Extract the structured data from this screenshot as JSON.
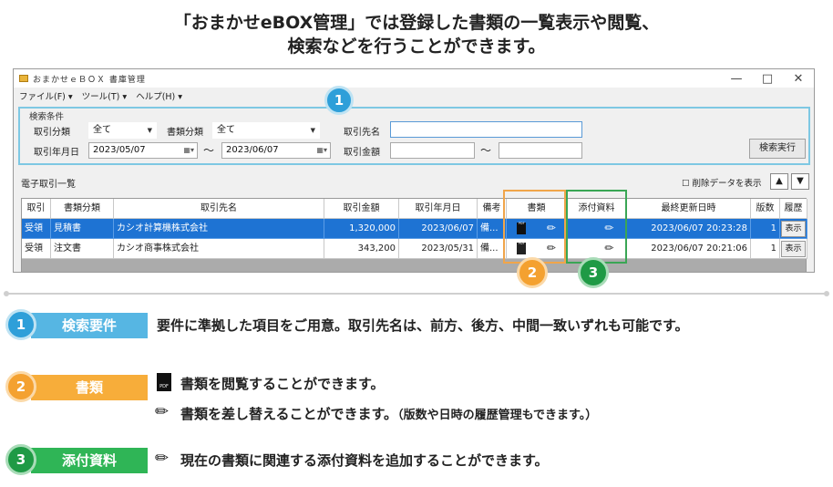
{
  "headline": {
    "line1": "「おまかせeBOX管理」では登録した書類の一覧表示や閲覧、",
    "line2": "検索などを行うことができます。"
  },
  "window": {
    "title": "おまかせｅＢＯＸ 書庫管理",
    "controls": {
      "minimize": "—",
      "maximize": "□",
      "close": "✕"
    },
    "menu": [
      "ファイル(F) ▾",
      "ツール(T) ▾",
      "ヘルプ(H) ▾"
    ]
  },
  "search": {
    "legend": "検索条件",
    "torihiki_bunrui_label": "取引分類",
    "torihiki_bunrui_value": "全て",
    "shorui_bunrui_label": "書類分類",
    "shorui_bunrui_value": "全て",
    "torihikisaki_label": "取引先名",
    "torihikisaki_value": "",
    "date_label": "取引年月日",
    "date_from": "2023/05/07",
    "date_to": "2023/06/07",
    "tilde": "〜",
    "kingaku_label": "取引金額",
    "kingaku_from": "",
    "kingaku_to": "",
    "run_button": "検索実行"
  },
  "list": {
    "title": "電子取引一覧",
    "show_deleted": "☐ 削除データを表示",
    "up_button": "▲",
    "down_button": "▼",
    "columns": [
      "取引",
      "書類分類",
      "取引先名",
      "取引金額",
      "取引年月日",
      "備考",
      "書類",
      "添付資料",
      "最終更新日時",
      "版数",
      "履歴"
    ],
    "rows": [
      {
        "torihiki": "受領",
        "bunrui": "見積書",
        "saki": "カシオ計算機株式会社",
        "kingaku": "1,320,000",
        "date": "2023/06/07",
        "biko": "備...",
        "updated": "2023/06/07 20:23:28",
        "hansu": "1",
        "rireki": "表示"
      },
      {
        "torihiki": "受領",
        "bunrui": "注文書",
        "saki": "カシオ商事株式会社",
        "kingaku": "343,200",
        "date": "2023/05/31",
        "biko": "備...",
        "updated": "2023/06/07 20:21:06",
        "hansu": "1",
        "rireki": "表示"
      }
    ]
  },
  "badges": {
    "one": "1",
    "two": "2",
    "three": "3"
  },
  "legend": {
    "items": [
      {
        "num": "1",
        "tag": "検索要件",
        "text": "要件に準拠した項目をご用意。取引先名は、前方、後方、中間一致いずれも可能です。"
      },
      {
        "num": "2",
        "tag": "書類",
        "text_view": "書類を閲覧することができます。",
        "text_replace": "書類を差し替えることができます。",
        "text_replace_note": "（版数や日時の履歴管理もできます。）"
      },
      {
        "num": "3",
        "tag": "添付資料",
        "text": "現在の書類に関連する添付資料を追加することができます。"
      }
    ]
  },
  "icons": {
    "pdf": "pdf-icon",
    "pen": "pen-icon",
    "pen_glyph": "✏"
  },
  "colors": {
    "blue": "#2e9fd9",
    "orange": "#f4a130",
    "green": "#1f9a45",
    "selection": "#1e73d3"
  }
}
